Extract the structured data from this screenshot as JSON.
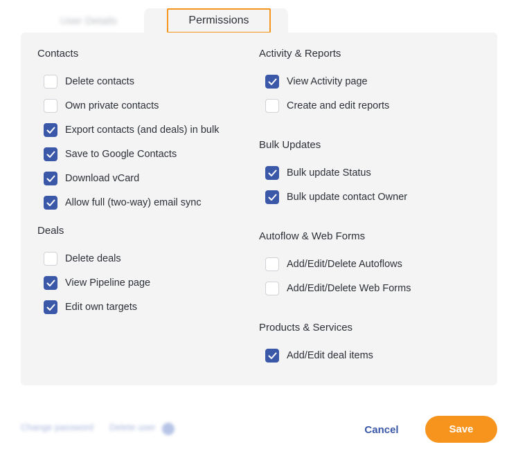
{
  "tabs": {
    "user_details": "User Details",
    "permissions": "Permissions"
  },
  "sections": {
    "contacts": {
      "title": "Contacts",
      "items": [
        {
          "label": "Delete contacts",
          "checked": false
        },
        {
          "label": "Own private contacts",
          "checked": false
        },
        {
          "label": "Export contacts (and deals) in bulk",
          "checked": true
        },
        {
          "label": "Save to Google Contacts",
          "checked": true
        },
        {
          "label": "Download vCard",
          "checked": true
        },
        {
          "label": "Allow full (two-way) email sync",
          "checked": true
        }
      ]
    },
    "deals": {
      "title": "Deals",
      "items": [
        {
          "label": "Delete deals",
          "checked": false
        },
        {
          "label": "View Pipeline page",
          "checked": true
        },
        {
          "label": "Edit own targets",
          "checked": true
        }
      ]
    },
    "activity": {
      "title": "Activity & Reports",
      "items": [
        {
          "label": "View Activity page",
          "checked": true
        },
        {
          "label": "Create and edit reports",
          "checked": false
        }
      ]
    },
    "bulk": {
      "title": "Bulk Updates",
      "items": [
        {
          "label": "Bulk update Status",
          "checked": true
        },
        {
          "label": "Bulk update contact Owner",
          "checked": true
        }
      ]
    },
    "autoflow": {
      "title": "Autoflow & Web Forms",
      "items": [
        {
          "label": "Add/Edit/Delete Autoflows",
          "checked": false
        },
        {
          "label": "Add/Edit/Delete Web Forms",
          "checked": false
        }
      ]
    },
    "products": {
      "title": "Products & Services",
      "items": [
        {
          "label": "Add/Edit deal items",
          "checked": true
        }
      ]
    }
  },
  "footer": {
    "change_password": "Change password",
    "delete_user": "Delete user",
    "cancel_label": "Cancel",
    "save_label": "Save"
  },
  "colors": {
    "accent": "#f7941d",
    "checkbox_checked": "#3a57a8",
    "panel_bg": "#f4f4f5"
  }
}
